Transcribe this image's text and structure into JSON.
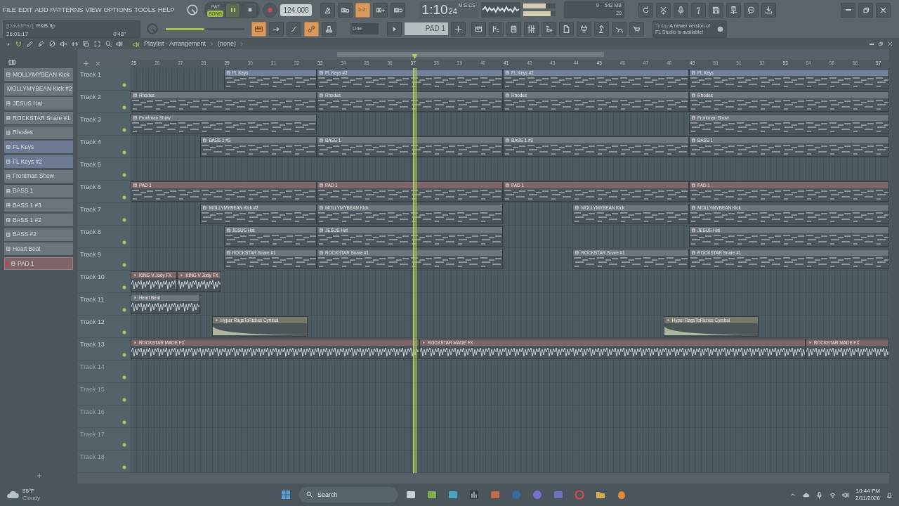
{
  "menu": [
    "FILE",
    "EDIT",
    "ADD",
    "PATTERNS",
    "VIEW",
    "OPTIONS",
    "TOOLS",
    "HELP"
  ],
  "project": {
    "owner": "[DavidPaz]",
    "file": "R&B.flp",
    "time": "26:01:17",
    "length": "0'48\""
  },
  "transport": {
    "modes": [
      {
        "label": "PAT",
        "selected": false
      },
      {
        "label": "SONG",
        "selected": true
      }
    ],
    "tempo": "124.000"
  },
  "record_toggles": [
    {
      "on": false
    },
    {
      "on": false
    },
    {
      "label": "3.2:",
      "on": true
    },
    {
      "on": false
    },
    {
      "on": false
    }
  ],
  "master_volume": {
    "level": 0.49
  },
  "edit_toggles": [
    {
      "on": true
    },
    {
      "on": false
    },
    {
      "on": false
    },
    {
      "on": true
    },
    {
      "on": false
    }
  ],
  "clock": {
    "main": "1:10",
    "centis": "24",
    "unit": "M:S:CS"
  },
  "output_meter": [
    {
      "level": 0.7
    },
    {
      "level": 0.85
    }
  ],
  "cpu": {
    "polyphony": "9",
    "memory": "542 MB",
    "cores": "20"
  },
  "snap": {
    "value": "Line"
  },
  "pattern_selector": {
    "value": "PAD 1"
  },
  "news": {
    "when": "Today",
    "text": "A newer version of FL Studio is available!"
  },
  "playlist": {
    "title": "Playlist - Arrangement",
    "clip": "(none)"
  },
  "patterns": [
    {
      "name": "MOLLYMYBEAN Kick",
      "color": "#6b757b",
      "selected": false
    },
    {
      "name": "MOLLYMYBEAN Kick #2",
      "color": "#6b757b",
      "selected": false
    },
    {
      "name": "JESUS Hat",
      "color": "#6b757b",
      "selected": false
    },
    {
      "name": "ROCKSTAR Snare #1",
      "color": "#6b757b",
      "selected": false
    },
    {
      "name": "Rhodes",
      "color": "#6b757b",
      "selected": false
    },
    {
      "name": "FL Keys",
      "color": "#6e7a93",
      "selected": false
    },
    {
      "name": "FL Keys #2",
      "color": "#6e7a93",
      "selected": false
    },
    {
      "name": "Frontman Show",
      "color": "#6b757b",
      "selected": false
    },
    {
      "name": "BASS 1",
      "color": "#6b757b",
      "selected": false
    },
    {
      "name": "BASS 1 #3",
      "color": "#6b757b",
      "selected": false
    },
    {
      "name": "BASS 1 #2",
      "color": "#6b757b",
      "selected": false
    },
    {
      "name": "BASS #2",
      "color": "#6b757b",
      "selected": false
    },
    {
      "name": "Heart Beat",
      "color": "#6b757b",
      "selected": false
    },
    {
      "name": "PAD 1",
      "color": "#7d6568",
      "selected": true
    }
  ],
  "ruler": [
    "25",
    "26",
    "27",
    "28",
    "29",
    "30",
    "31",
    "32",
    "33",
    "34",
    "35",
    "36",
    "37",
    "38",
    "39",
    "40",
    "41",
    "42",
    "43",
    "44",
    "45",
    "46",
    "47",
    "48",
    "49",
    "50",
    "51",
    "52",
    "53",
    "54",
    "55",
    "56",
    "57"
  ],
  "tracks": [
    {
      "name": "Track 1",
      "dimmed": false,
      "clips": [
        {
          "kind": "pattern",
          "name": "FL Keys",
          "color": "#737f98"
        },
        {
          "kind": "pattern",
          "name": "FL Keys #2",
          "color": "#737f98"
        },
        {
          "kind": "pattern",
          "name": "FL Keys #2",
          "color": "#737f98"
        },
        {
          "kind": "pattern",
          "name": "FL Keys",
          "color": "#737f98"
        }
      ]
    },
    {
      "name": "Track 2",
      "dimmed": false,
      "clips": [
        {
          "kind": "pattern",
          "name": "Rhodes",
          "color": "#6c767b"
        },
        {
          "kind": "pattern",
          "name": "Rhodes",
          "color": "#6c767b"
        },
        {
          "kind": "pattern",
          "name": "Rhodes",
          "color": "#6c767b"
        },
        {
          "kind": "pattern",
          "name": "Rhodes",
          "color": "#6c767b"
        }
      ]
    },
    {
      "name": "Track 3",
      "dimmed": false,
      "clips": [
        {
          "kind": "pattern",
          "name": "Frontman Show",
          "color": "#6c767b"
        },
        {
          "kind": "pattern",
          "name": "Frontman Show",
          "color": "#6c767b"
        }
      ]
    },
    {
      "name": "Track 4",
      "dimmed": false,
      "clips": [
        {
          "kind": "pattern",
          "name": "BASS 1 #3",
          "color": "#6c767b"
        },
        {
          "kind": "pattern",
          "name": "BASS 1",
          "color": "#6c767b"
        },
        {
          "kind": "pattern",
          "name": "BASS 1 #2",
          "color": "#6c767b"
        },
        {
          "kind": "pattern",
          "name": "BASS 1",
          "color": "#6c767b"
        }
      ]
    },
    {
      "name": "Track 5",
      "dimmed": false
    },
    {
      "name": "Track 6",
      "dimmed": false,
      "clips": [
        {
          "kind": "pattern",
          "name": "PAD 1",
          "color": "#7d6568"
        },
        {
          "kind": "pattern",
          "name": "PAD 1",
          "color": "#7d6568"
        },
        {
          "kind": "pattern",
          "name": "PAD 1",
          "color": "#7d6568"
        },
        {
          "kind": "pattern",
          "name": "PAD 1",
          "color": "#7d6568"
        }
      ]
    },
    {
      "name": "Track 7",
      "dimmed": false,
      "clips": [
        {
          "kind": "pattern",
          "name": "MOLLYMYBEAN Kick #2",
          "color": "#6c767b"
        },
        {
          "kind": "pattern",
          "name": "MOLLYMYBEAN Kick",
          "color": "#6c767b"
        },
        {
          "kind": "pattern",
          "name": "MOLLYMYBEAN Kick",
          "color": "#6c767b"
        },
        {
          "kind": "pattern",
          "name": "MOLLYMYBEAN Kick",
          "color": "#6c767b"
        }
      ]
    },
    {
      "name": "Track 8",
      "dimmed": false,
      "clips": [
        {
          "kind": "pattern",
          "name": "JESUS Hat",
          "color": "#6c767b"
        },
        {
          "kind": "pattern",
          "name": "JESUS Hat",
          "color": "#6c767b"
        },
        {
          "kind": "pattern",
          "name": "JESUS Hat",
          "color": "#6c767b"
        }
      ]
    },
    {
      "name": "Track 9",
      "dimmed": false,
      "clips": [
        {
          "kind": "pattern",
          "name": "ROCKSTAR Snare #1",
          "color": "#6c767b"
        },
        {
          "kind": "pattern",
          "name": "ROCKSTAR Snare #1",
          "color": "#6c767b"
        },
        {
          "kind": "pattern",
          "name": "ROCKSTAR Snare #1",
          "color": "#6c767b"
        },
        {
          "kind": "pattern",
          "name": "ROCKSTAR Snare #1",
          "color": "#6c767b"
        }
      ]
    },
    {
      "name": "Track 10",
      "dimmed": false,
      "clips": [
        {
          "kind": "audio",
          "name": "KING V Jody FX",
          "color": "#7d6568"
        },
        {
          "kind": "audio",
          "name": "KING V Jody FX",
          "color": "#7d6568"
        }
      ]
    },
    {
      "name": "Track 11",
      "dimmed": false,
      "clips": [
        {
          "kind": "audio",
          "name": "Heart Beat",
          "color": "#6c767b"
        }
      ]
    },
    {
      "name": "Track 12",
      "dimmed": false,
      "clips": [
        {
          "kind": "fade",
          "name": "Hyper RagsToRiches Cymbal",
          "color": "#757a6a"
        },
        {
          "kind": "fade",
          "name": "Hyper RagsToRiches Cymbal",
          "color": "#757a6a"
        }
      ]
    },
    {
      "name": "Track 13",
      "dimmed": false,
      "clips": [
        {
          "kind": "audio",
          "name": "ROCKSTAR MADE FX",
          "color": "#7d6568"
        },
        {
          "kind": "audio",
          "name": "ROCKSTAR MADE FX",
          "color": "#7d6568"
        },
        {
          "kind": "audio",
          "name": "ROCKSTAR MADE FX",
          "color": "#7d6568"
        }
      ]
    },
    {
      "name": "Track 14",
      "dimmed": true
    },
    {
      "name": "Track 15",
      "dimmed": true
    },
    {
      "name": "Track 16",
      "dimmed": true
    },
    {
      "name": "Track 17",
      "dimmed": true
    },
    {
      "name": "Track 18",
      "dimmed": true
    }
  ],
  "taskbar": {
    "temperature": "55°F",
    "condition": "Cloudy",
    "search": {
      "placeholder": "Search"
    },
    "time": "10:44 PM",
    "date": "2/11/2026"
  }
}
